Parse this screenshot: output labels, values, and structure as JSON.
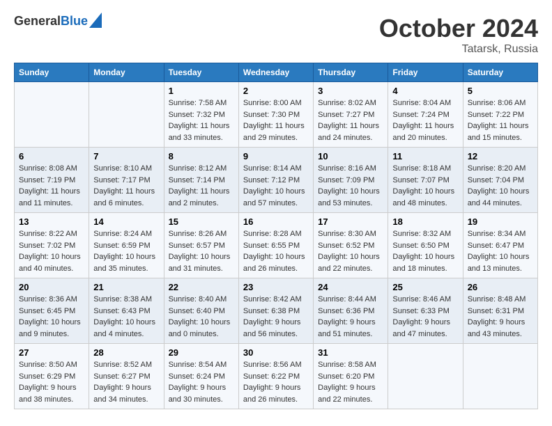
{
  "header": {
    "logo_general": "General",
    "logo_blue": "Blue",
    "title": "October 2024",
    "location": "Tatarsk, Russia"
  },
  "days_of_week": [
    "Sunday",
    "Monday",
    "Tuesday",
    "Wednesday",
    "Thursday",
    "Friday",
    "Saturday"
  ],
  "weeks": [
    [
      {
        "num": "",
        "sunrise": "",
        "sunset": "",
        "daylight": ""
      },
      {
        "num": "",
        "sunrise": "",
        "sunset": "",
        "daylight": ""
      },
      {
        "num": "1",
        "sunrise": "Sunrise: 7:58 AM",
        "sunset": "Sunset: 7:32 PM",
        "daylight": "Daylight: 11 hours and 33 minutes."
      },
      {
        "num": "2",
        "sunrise": "Sunrise: 8:00 AM",
        "sunset": "Sunset: 7:30 PM",
        "daylight": "Daylight: 11 hours and 29 minutes."
      },
      {
        "num": "3",
        "sunrise": "Sunrise: 8:02 AM",
        "sunset": "Sunset: 7:27 PM",
        "daylight": "Daylight: 11 hours and 24 minutes."
      },
      {
        "num": "4",
        "sunrise": "Sunrise: 8:04 AM",
        "sunset": "Sunset: 7:24 PM",
        "daylight": "Daylight: 11 hours and 20 minutes."
      },
      {
        "num": "5",
        "sunrise": "Sunrise: 8:06 AM",
        "sunset": "Sunset: 7:22 PM",
        "daylight": "Daylight: 11 hours and 15 minutes."
      }
    ],
    [
      {
        "num": "6",
        "sunrise": "Sunrise: 8:08 AM",
        "sunset": "Sunset: 7:19 PM",
        "daylight": "Daylight: 11 hours and 11 minutes."
      },
      {
        "num": "7",
        "sunrise": "Sunrise: 8:10 AM",
        "sunset": "Sunset: 7:17 PM",
        "daylight": "Daylight: 11 hours and 6 minutes."
      },
      {
        "num": "8",
        "sunrise": "Sunrise: 8:12 AM",
        "sunset": "Sunset: 7:14 PM",
        "daylight": "Daylight: 11 hours and 2 minutes."
      },
      {
        "num": "9",
        "sunrise": "Sunrise: 8:14 AM",
        "sunset": "Sunset: 7:12 PM",
        "daylight": "Daylight: 10 hours and 57 minutes."
      },
      {
        "num": "10",
        "sunrise": "Sunrise: 8:16 AM",
        "sunset": "Sunset: 7:09 PM",
        "daylight": "Daylight: 10 hours and 53 minutes."
      },
      {
        "num": "11",
        "sunrise": "Sunrise: 8:18 AM",
        "sunset": "Sunset: 7:07 PM",
        "daylight": "Daylight: 10 hours and 48 minutes."
      },
      {
        "num": "12",
        "sunrise": "Sunrise: 8:20 AM",
        "sunset": "Sunset: 7:04 PM",
        "daylight": "Daylight: 10 hours and 44 minutes."
      }
    ],
    [
      {
        "num": "13",
        "sunrise": "Sunrise: 8:22 AM",
        "sunset": "Sunset: 7:02 PM",
        "daylight": "Daylight: 10 hours and 40 minutes."
      },
      {
        "num": "14",
        "sunrise": "Sunrise: 8:24 AM",
        "sunset": "Sunset: 6:59 PM",
        "daylight": "Daylight: 10 hours and 35 minutes."
      },
      {
        "num": "15",
        "sunrise": "Sunrise: 8:26 AM",
        "sunset": "Sunset: 6:57 PM",
        "daylight": "Daylight: 10 hours and 31 minutes."
      },
      {
        "num": "16",
        "sunrise": "Sunrise: 8:28 AM",
        "sunset": "Sunset: 6:55 PM",
        "daylight": "Daylight: 10 hours and 26 minutes."
      },
      {
        "num": "17",
        "sunrise": "Sunrise: 8:30 AM",
        "sunset": "Sunset: 6:52 PM",
        "daylight": "Daylight: 10 hours and 22 minutes."
      },
      {
        "num": "18",
        "sunrise": "Sunrise: 8:32 AM",
        "sunset": "Sunset: 6:50 PM",
        "daylight": "Daylight: 10 hours and 18 minutes."
      },
      {
        "num": "19",
        "sunrise": "Sunrise: 8:34 AM",
        "sunset": "Sunset: 6:47 PM",
        "daylight": "Daylight: 10 hours and 13 minutes."
      }
    ],
    [
      {
        "num": "20",
        "sunrise": "Sunrise: 8:36 AM",
        "sunset": "Sunset: 6:45 PM",
        "daylight": "Daylight: 10 hours and 9 minutes."
      },
      {
        "num": "21",
        "sunrise": "Sunrise: 8:38 AM",
        "sunset": "Sunset: 6:43 PM",
        "daylight": "Daylight: 10 hours and 4 minutes."
      },
      {
        "num": "22",
        "sunrise": "Sunrise: 8:40 AM",
        "sunset": "Sunset: 6:40 PM",
        "daylight": "Daylight: 10 hours and 0 minutes."
      },
      {
        "num": "23",
        "sunrise": "Sunrise: 8:42 AM",
        "sunset": "Sunset: 6:38 PM",
        "daylight": "Daylight: 9 hours and 56 minutes."
      },
      {
        "num": "24",
        "sunrise": "Sunrise: 8:44 AM",
        "sunset": "Sunset: 6:36 PM",
        "daylight": "Daylight: 9 hours and 51 minutes."
      },
      {
        "num": "25",
        "sunrise": "Sunrise: 8:46 AM",
        "sunset": "Sunset: 6:33 PM",
        "daylight": "Daylight: 9 hours and 47 minutes."
      },
      {
        "num": "26",
        "sunrise": "Sunrise: 8:48 AM",
        "sunset": "Sunset: 6:31 PM",
        "daylight": "Daylight: 9 hours and 43 minutes."
      }
    ],
    [
      {
        "num": "27",
        "sunrise": "Sunrise: 8:50 AM",
        "sunset": "Sunset: 6:29 PM",
        "daylight": "Daylight: 9 hours and 38 minutes."
      },
      {
        "num": "28",
        "sunrise": "Sunrise: 8:52 AM",
        "sunset": "Sunset: 6:27 PM",
        "daylight": "Daylight: 9 hours and 34 minutes."
      },
      {
        "num": "29",
        "sunrise": "Sunrise: 8:54 AM",
        "sunset": "Sunset: 6:24 PM",
        "daylight": "Daylight: 9 hours and 30 minutes."
      },
      {
        "num": "30",
        "sunrise": "Sunrise: 8:56 AM",
        "sunset": "Sunset: 6:22 PM",
        "daylight": "Daylight: 9 hours and 26 minutes."
      },
      {
        "num": "31",
        "sunrise": "Sunrise: 8:58 AM",
        "sunset": "Sunset: 6:20 PM",
        "daylight": "Daylight: 9 hours and 22 minutes."
      },
      {
        "num": "",
        "sunrise": "",
        "sunset": "",
        "daylight": ""
      },
      {
        "num": "",
        "sunrise": "",
        "sunset": "",
        "daylight": ""
      }
    ]
  ]
}
